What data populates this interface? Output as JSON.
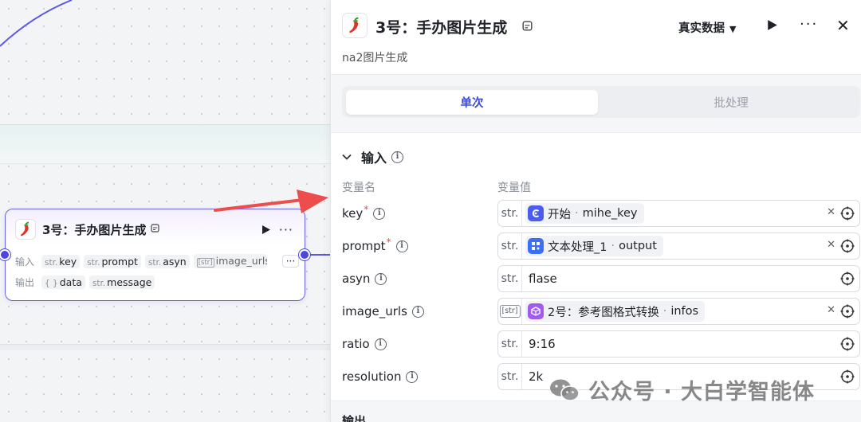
{
  "canvas_node": {
    "title": "3号：手办图片生成",
    "input_label": "输入",
    "output_label": "输出",
    "inputs": [
      {
        "type": "str.",
        "name": "key"
      },
      {
        "type": "str.",
        "name": "prompt"
      },
      {
        "type": "str.",
        "name": "asyn"
      },
      {
        "type": "[str]",
        "name": "image_urls"
      }
    ],
    "more_inputs": "···",
    "outputs": [
      {
        "type": "{ }",
        "name": "data"
      },
      {
        "type": "str.",
        "name": "message"
      }
    ]
  },
  "panel": {
    "title": "3号：手办图片生成",
    "subtitle": "na2图片生成",
    "data_mode": "真实数据",
    "tabs": {
      "single": "单次",
      "batch": "批处理"
    },
    "input_section": "输入",
    "col_var_name": "变量名",
    "col_var_value": "变量值",
    "fields": [
      {
        "name": "key",
        "required": true,
        "type": "str.",
        "kind": "ref",
        "source": "开始",
        "var": "mihe_key",
        "icon_color": "#4b5cf0",
        "icon": "start-icon"
      },
      {
        "name": "prompt",
        "required": true,
        "type": "str.",
        "kind": "ref",
        "source": "文本处理_1",
        "var": "output",
        "icon_color": "#3b6ff5",
        "icon": "text-process-icon"
      },
      {
        "name": "asyn",
        "required": false,
        "type": "str.",
        "kind": "value",
        "value": "flase"
      },
      {
        "name": "image_urls",
        "required": false,
        "type": "[str]",
        "kind": "ref",
        "source": "2号：参考图格式转换",
        "var": "infos",
        "icon_color": "#a35af2",
        "icon": "cube-icon"
      },
      {
        "name": "ratio",
        "required": false,
        "type": "str.",
        "kind": "value",
        "value": "9:16"
      },
      {
        "name": "resolution",
        "required": false,
        "type": "str.",
        "kind": "value",
        "value": "2k"
      }
    ],
    "output_section": "输出"
  },
  "watermark": "公众号 · 大白学智能体",
  "colors": {
    "accent": "#3a4bd6",
    "port": "#4b47e0",
    "arrow": "#ee4d4d",
    "edge": "#5b57e6"
  }
}
